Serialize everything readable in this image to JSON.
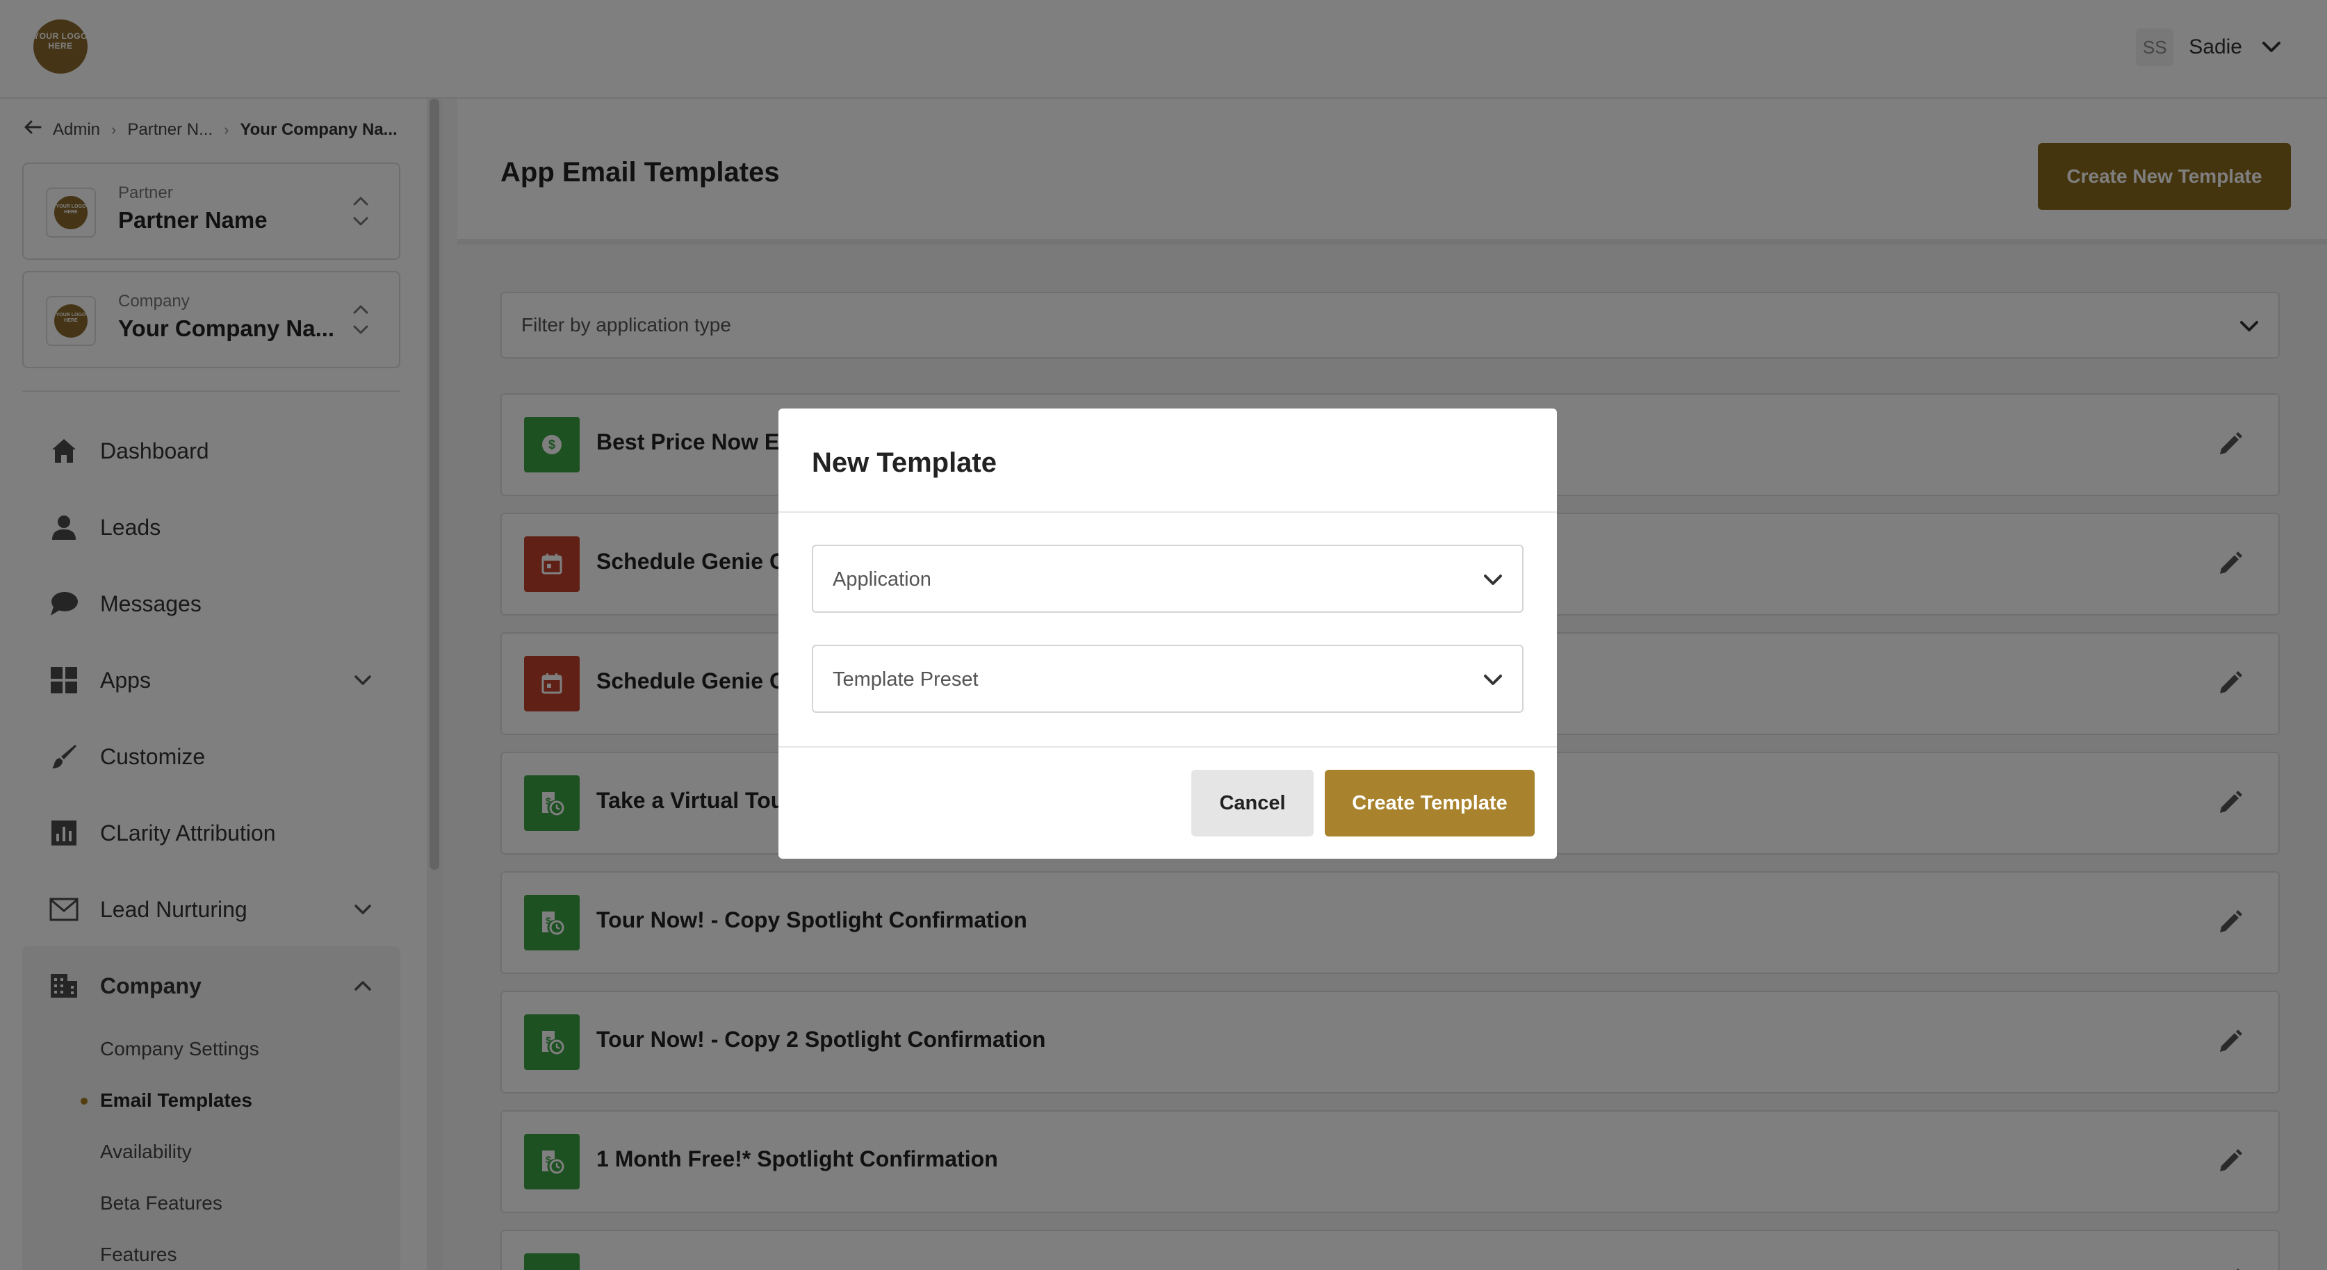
{
  "header": {
    "logo_text": "YOUR LOGO HERE",
    "user_initials": "SS",
    "user_name": "Sadie"
  },
  "breadcrumb": {
    "items": [
      "Admin",
      "Partner N...",
      "Your Company Na..."
    ]
  },
  "partner_selector": {
    "label": "Partner",
    "value": "Partner Name"
  },
  "company_selector": {
    "label": "Company",
    "value": "Your Company Na..."
  },
  "nav": [
    {
      "label": "Dashboard",
      "icon": "home-icon"
    },
    {
      "label": "Leads",
      "icon": "person-icon"
    },
    {
      "label": "Messages",
      "icon": "chat-icon"
    },
    {
      "label": "Apps",
      "icon": "grid-icon",
      "expandable": true
    },
    {
      "label": "Customize",
      "icon": "brush-icon"
    },
    {
      "label": "CLarity Attribution",
      "icon": "bar-chart-icon"
    },
    {
      "label": "Lead Nurturing",
      "icon": "envelope-icon",
      "expandable": true
    },
    {
      "label": "Company",
      "icon": "building-icon",
      "expanded": true
    }
  ],
  "company_subnav": [
    {
      "label": "Company Settings"
    },
    {
      "label": "Email Templates",
      "active": true
    },
    {
      "label": "Availability"
    },
    {
      "label": "Beta Features"
    },
    {
      "label": "Features"
    }
  ],
  "main": {
    "title": "App Email Templates",
    "create_button": "Create New Template",
    "filter_placeholder": "Filter by application type"
  },
  "templates": [
    {
      "title": "Best Price Now Est",
      "icon": "dollar-icon",
      "color": "#3aa344"
    },
    {
      "title": "Schedule Genie C",
      "icon": "calendar-icon",
      "color": "#c2412a"
    },
    {
      "title": "Schedule Genie C",
      "icon": "calendar-icon",
      "color": "#c2412a"
    },
    {
      "title": "Take a Virtual Tou",
      "icon": "price-clock-icon",
      "color": "#3aa344"
    },
    {
      "title": "Tour Now! - Copy Spotlight Confirmation",
      "icon": "price-clock-icon",
      "color": "#3aa344"
    },
    {
      "title": "Tour Now! - Copy 2 Spotlight Confirmation",
      "icon": "price-clock-icon",
      "color": "#3aa344"
    },
    {
      "title": "1 Month Free!* Spotlight Confirmation",
      "icon": "price-clock-icon",
      "color": "#3aa344"
    },
    {
      "title": "",
      "icon": "price-clock-icon",
      "color": "#3aa344"
    }
  ],
  "modal": {
    "title": "New Template",
    "application_placeholder": "Application",
    "preset_placeholder": "Template Preset",
    "cancel_label": "Cancel",
    "create_label": "Create Template"
  },
  "colors": {
    "brand_gold": "#8a6a1c",
    "accent_gold": "#a8822c",
    "green": "#3aa344",
    "red": "#c2412a"
  }
}
